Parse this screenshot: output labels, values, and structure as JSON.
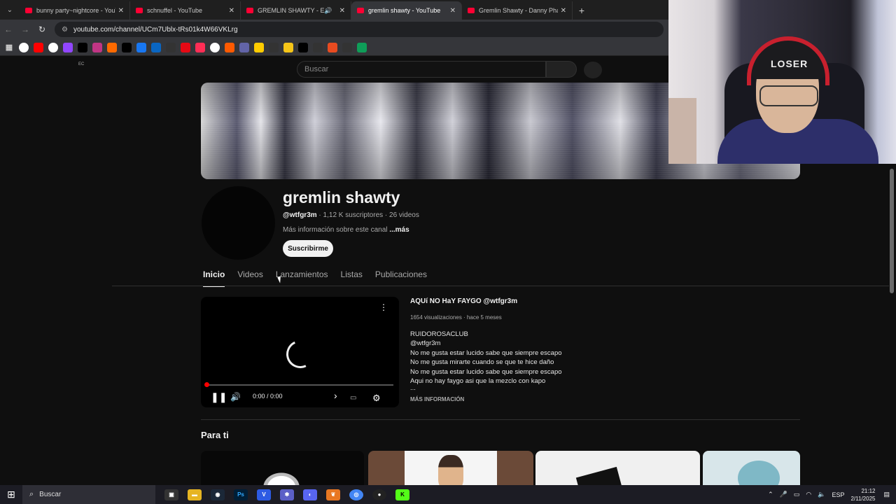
{
  "browser": {
    "tabs": [
      {
        "title": "bunny party~nightcore - YouTube",
        "active": false,
        "audio": false
      },
      {
        "title": "schnuffel - YouTube",
        "active": false,
        "audio": false
      },
      {
        "title": "GREMLIN SHAWTY - ESTA N",
        "active": false,
        "audio": true
      },
      {
        "title": "gremlin shawty - YouTube",
        "active": true,
        "audio": false
      },
      {
        "title": "Gremlin Shawty - Danny Phantom",
        "active": false,
        "audio": false
      }
    ],
    "url": "youtube.com/channel/UCm7Ublx-tRs01k4W66VKLrg",
    "bookmark_colors": [
      "#ffffff",
      "#ff0000",
      "#ffffff",
      "#9146ff",
      "#000000",
      "#c13584",
      "#ff6a00",
      "#000000",
      "#1877f2",
      "#0a66c2",
      "#333333",
      "#e50914",
      "#ff2d55",
      "#ffffff",
      "#ff5a00",
      "#6264a7",
      "#ffcc00",
      "#333333",
      "#f5c518",
      "#000000",
      "#333333",
      "#e84b20",
      "#333333",
      "#0f9d58"
    ]
  },
  "youtube": {
    "region": "EC",
    "search_placeholder": "Buscar",
    "channel": {
      "name": "gremlin shawty",
      "handle": "@wtfgr3m",
      "meta": " · 1,12 K suscriptores · 26 videos",
      "desc": "Más información sobre este canal ",
      "desc_more": "...más",
      "subscribe": "Suscribirme"
    },
    "tabs": [
      "Inicio",
      "Videos",
      "Lanzamientos",
      "Listas",
      "Publicaciones"
    ],
    "featured": {
      "title": "AQUí NO HaY FAYGO @wtfgr3m",
      "stats": "1654 visualizaciones · hace 5 meses",
      "description": [
        "RUIDOROSACLUB",
        "@wtfgr3m",
        "No me gusta estar lucido sabe que siempre escapo",
        "No me gusta mirarte cuando se que te hice daño",
        "No me gusta estar lucido sabe que siempre escapo",
        "Aqui no hay faygo asi que la mezclo con kapo",
        "..."
      ],
      "more": "MÁS INFORMACIÓN",
      "time": "0:00 / 0:00",
      "progress": 0
    },
    "section_title": "Para ti"
  },
  "webcam": {
    "beanie_text": "LOSER"
  },
  "taskbar": {
    "search": "Buscar",
    "language": "ESP",
    "time": "21:12",
    "date": "2/11/2025"
  }
}
